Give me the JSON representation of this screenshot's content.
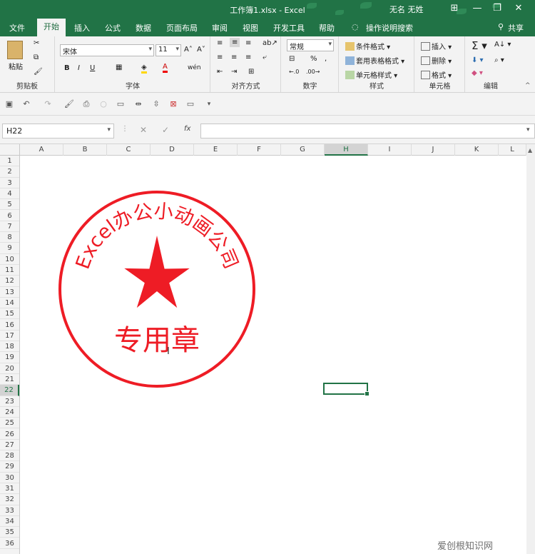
{
  "window": {
    "title": "工作簿1.xlsx - Excel",
    "user": "无名 无姓",
    "min": "—",
    "restore": "❐",
    "close": "✕",
    "ribbon_opts": "⊞"
  },
  "tabs": [
    "文件",
    "开始",
    "插入",
    "公式",
    "数据",
    "页面布局",
    "审阅",
    "视图",
    "开发工具",
    "帮助"
  ],
  "tell_me": "操作说明搜索",
  "share": "共享",
  "ribbon": {
    "clipboard": {
      "label": "剪贴板",
      "paste": "粘贴"
    },
    "font": {
      "label": "字体",
      "name": "宋体",
      "size": "11",
      "bold": "B",
      "italic": "I",
      "underline": "U",
      "grow": "A˄",
      "shrink": "A˅",
      "phonetic": "wén"
    },
    "alignment": {
      "label": "对齐方式"
    },
    "number": {
      "label": "数字",
      "format": "常规"
    },
    "styles": {
      "label": "样式",
      "cond": "条件格式",
      "table": "套用表格格式",
      "cell": "单元格样式"
    },
    "cells": {
      "label": "单元格",
      "insert": "插入",
      "delete": "删除",
      "format": "格式"
    },
    "editing": {
      "label": "编辑"
    }
  },
  "namebox": "H22",
  "formula_icons": {
    "cancel": "✕",
    "enter": "✓",
    "fx": "fx"
  },
  "columns": [
    "A",
    "B",
    "C",
    "D",
    "E",
    "F",
    "G",
    "H",
    "I",
    "J",
    "K",
    "L"
  ],
  "rows": [
    "1",
    "2",
    "3",
    "4",
    "5",
    "6",
    "7",
    "8",
    "9",
    "10",
    "11",
    "12",
    "13",
    "14",
    "15",
    "16",
    "17",
    "18",
    "19",
    "20",
    "21",
    "22",
    "23",
    "24",
    "25",
    "26",
    "27",
    "28",
    "29",
    "30",
    "31",
    "32",
    "33",
    "34",
    "35",
    "36"
  ],
  "selected_cell": "H22",
  "seal": {
    "arc_text": "Excel办公小动画公司",
    "center_text": "专用章",
    "color": "#ee1c25"
  },
  "watermark": "爱创根知识网"
}
